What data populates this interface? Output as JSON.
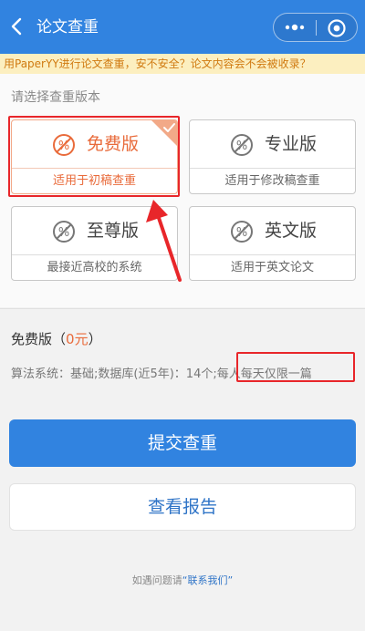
{
  "navbar": {
    "title": "论文查重",
    "back_icon": "chevron-left-icon",
    "more_icon": "more-dots-icon",
    "close_icon": "target-close-icon"
  },
  "notice": {
    "text": "用PaperYY进行论文查重，安不安全？论文内容会不会被收录？"
  },
  "versions": {
    "label": "请选择查重版本",
    "options": [
      {
        "name": "免费版",
        "desc": "适用于初稿查重",
        "selected": true
      },
      {
        "name": "专业版",
        "desc": "适用于修改稿查重",
        "selected": false
      },
      {
        "name": "至尊版",
        "desc": "最接近高校的系统",
        "selected": false
      },
      {
        "name": "英文版",
        "desc": "适用于英文论文",
        "selected": false
      }
    ]
  },
  "plan": {
    "name": "免费版",
    "open": "（",
    "price": "0元",
    "close": "）",
    "algo": "算法系统：基础;数据库(近5年)：14个;",
    "limit": "每人每天仅限一篇"
  },
  "buttons": {
    "submit": "提交查重",
    "report": "查看报告"
  },
  "footer": {
    "prefix": "如遇问题请",
    "quote_open": "“",
    "link": "联系我们",
    "quote_close": "”"
  },
  "colors": {
    "primary": "#3183e0",
    "accent": "#e96b3b",
    "highlight": "#e8262a"
  }
}
